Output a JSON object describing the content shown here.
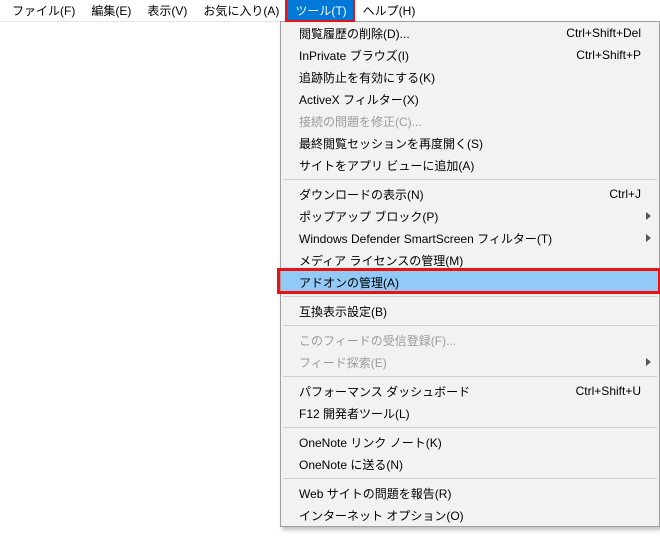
{
  "menubar": {
    "items": [
      {
        "label": "ファイル(F)"
      },
      {
        "label": "編集(E)"
      },
      {
        "label": "表示(V)"
      },
      {
        "label": "お気に入り(A)"
      },
      {
        "label": "ツール(T)",
        "active": true
      },
      {
        "label": "ヘルプ(H)"
      }
    ]
  },
  "dropdown": {
    "groups": [
      [
        {
          "label": "閲覧履歴の削除(D)...",
          "shortcut": "Ctrl+Shift+Del"
        },
        {
          "label": "InPrivate ブラウズ(I)",
          "shortcut": "Ctrl+Shift+P"
        },
        {
          "label": "追跡防止を有効にする(K)"
        },
        {
          "label": "ActiveX フィルター(X)"
        },
        {
          "label": "接続の問題を修正(C)...",
          "disabled": true
        },
        {
          "label": "最終閲覧セッションを再度開く(S)"
        },
        {
          "label": "サイトをアプリ ビューに追加(A)"
        }
      ],
      [
        {
          "label": "ダウンロードの表示(N)",
          "shortcut": "Ctrl+J"
        },
        {
          "label": "ポップアップ ブロック(P)",
          "submenu": true
        },
        {
          "label": "Windows Defender SmartScreen フィルター(T)",
          "submenu": true
        },
        {
          "label": "メディア ライセンスの管理(M)"
        },
        {
          "label": "アドオンの管理(A)",
          "highlight": true
        }
      ],
      [
        {
          "label": "互換表示設定(B)"
        }
      ],
      [
        {
          "label": "このフィードの受信登録(F)...",
          "disabled": true
        },
        {
          "label": "フィード探索(E)",
          "submenu": true,
          "disabled": true
        }
      ],
      [
        {
          "label": "パフォーマンス ダッシュボード",
          "shortcut": "Ctrl+Shift+U"
        },
        {
          "label": "F12 開発者ツール(L)"
        }
      ],
      [
        {
          "label": "OneNote リンク ノート(K)"
        },
        {
          "label": "OneNote に送る(N)"
        }
      ],
      [
        {
          "label": "Web サイトの問題を報告(R)"
        },
        {
          "label": "インターネット オプション(O)"
        }
      ]
    ]
  }
}
